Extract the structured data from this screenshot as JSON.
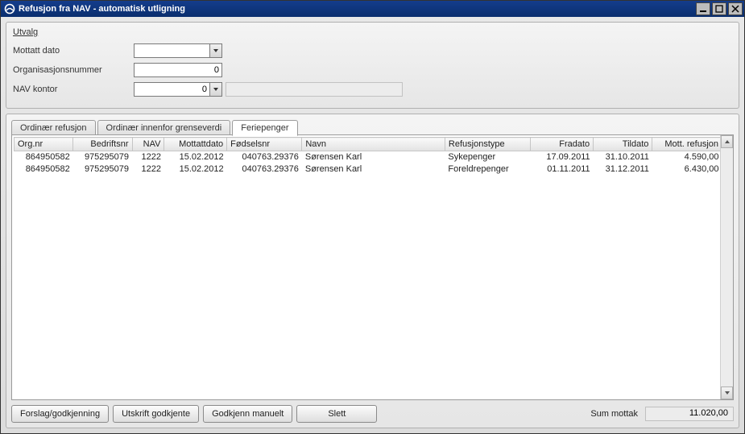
{
  "window": {
    "title": "Refusjon fra NAV - automatisk utligning"
  },
  "utvalg": {
    "title": "Utvalg",
    "mottatt_label": "Mottatt dato",
    "mottatt_value": "",
    "orgnr_label": "Organisasjonsnummer",
    "orgnr_value": "0",
    "navkontor_label": "NAV kontor",
    "navkontor_value": "0",
    "navkontor_text": ""
  },
  "tabs": {
    "ordinaer": "Ordinær refusjon",
    "grenseverdi": "Ordinær innenfor grenseverdi",
    "ferie": "Feriepenger"
  },
  "grid": {
    "columns": {
      "orgnr": "Org.nr",
      "bedriftsnr": "Bedriftsnr",
      "nav": "NAV",
      "mottattdato": "Mottattdato",
      "fodselsnr": "Fødselsnr",
      "navn": "Navn",
      "refusjonstype": "Refusjonstype",
      "fradato": "Fradato",
      "tildato": "Tildato",
      "mott_refusjon": "Mott. refusjon"
    },
    "rows": [
      {
        "orgnr": "864950582",
        "bedriftsnr": "975295079",
        "nav": "1222",
        "mottattdato": "15.02.2012",
        "fodselsnr": "040763.29376",
        "navn": "Sørensen Karl",
        "refusjonstype": "Sykepenger",
        "fradato": "17.09.2011",
        "tildato": "31.10.2011",
        "mott_refusjon": "4.590,00"
      },
      {
        "orgnr": "864950582",
        "bedriftsnr": "975295079",
        "nav": "1222",
        "mottattdato": "15.02.2012",
        "fodselsnr": "040763.29376",
        "navn": "Sørensen Karl",
        "refusjonstype": "Foreldrepenger",
        "fradato": "01.11.2011",
        "tildato": "31.12.2011",
        "mott_refusjon": "6.430,00"
      }
    ]
  },
  "footer": {
    "forslag": "Forslag/godkjenning",
    "utskrift": "Utskrift godkjente",
    "godkjenn": "Godkjenn manuelt",
    "slett": "Slett",
    "sum_label": "Sum mottak",
    "sum_value": "11.020,00"
  }
}
